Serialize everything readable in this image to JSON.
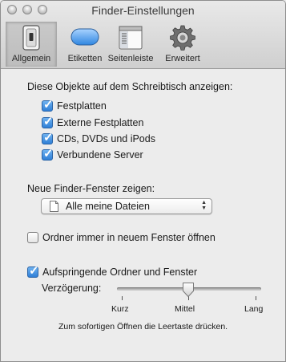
{
  "window": {
    "title": "Finder-Einstellungen"
  },
  "toolbar": {
    "tabs": [
      {
        "label": "Allgemein",
        "icon": "switch-icon",
        "selected": true
      },
      {
        "label": "Etiketten",
        "icon": "label-icon",
        "selected": false
      },
      {
        "label": "Seitenleiste",
        "icon": "sidebar-icon",
        "selected": false
      },
      {
        "label": "Erweitert",
        "icon": "gear-icon",
        "selected": false
      }
    ]
  },
  "desktop": {
    "heading": "Diese Objekte auf dem Schreibtisch anzeigen:",
    "items": [
      {
        "label": "Festplatten",
        "checked": true
      },
      {
        "label": "Externe Festplatten",
        "checked": true
      },
      {
        "label": "CDs, DVDs und iPods",
        "checked": true
      },
      {
        "label": "Verbundene Server",
        "checked": true
      }
    ]
  },
  "new_window": {
    "heading": "Neue Finder-Fenster zeigen:",
    "selected": "Alle meine Dateien"
  },
  "options": {
    "open_in_new_window": {
      "label": "Ordner immer in neuem Fenster öffnen",
      "checked": false
    },
    "spring_loaded": {
      "label": "Aufspringende Ordner und Fenster",
      "checked": true
    }
  },
  "delay": {
    "label": "Verzögerung:",
    "min_label": "Kurz",
    "mid_label": "Mittel",
    "max_label": "Lang",
    "value": 0.5,
    "hint": "Zum sofortigen Öffnen die Leertaste drücken."
  },
  "colors": {
    "checkbox_on": "#2f7fd6",
    "toolbar_bg": "#d8d8d8",
    "window_bg": "#ececec"
  }
}
